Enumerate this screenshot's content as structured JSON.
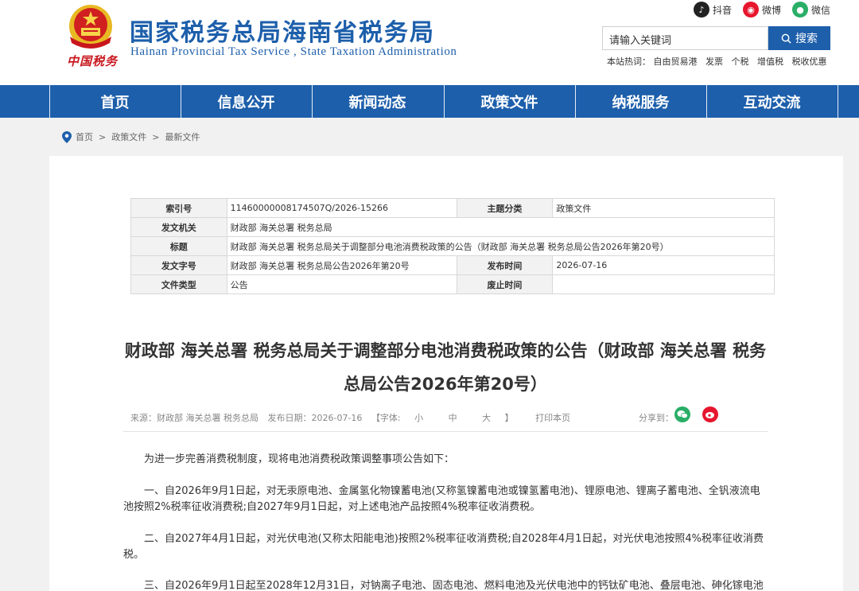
{
  "header": {
    "site_title": "国家税务总局海南省税务局",
    "site_subtitle": "Hainan Provincial Tax Service , State Taxation Administration",
    "seal_text": "中国税务",
    "social": [
      {
        "icon": "douyin-icon",
        "label": "抖音",
        "color": "#222222"
      },
      {
        "icon": "weibo-icon",
        "label": "微博",
        "color": "#e6162d"
      },
      {
        "icon": "wechat-icon",
        "label": "微信",
        "color": "#2aae67"
      }
    ],
    "search_placeholder": "请输入关键词",
    "search_button": "搜索",
    "hot_label": "本站热词：",
    "hot_words": [
      "自由贸易港",
      "发票",
      "个税",
      "增值税",
      "税收优惠"
    ]
  },
  "nav": [
    "首页",
    "信息公开",
    "新闻动态",
    "政策文件",
    "纳税服务",
    "互动交流"
  ],
  "breadcrumb": [
    "首页",
    "政策文件",
    "最新文件"
  ],
  "meta": {
    "index_label": "索引号",
    "index_value": "11460000008174507Q/2026-15266",
    "topic_label": "主题分类",
    "topic_value": "政策文件",
    "issuer_label": "发文机关",
    "issuer_value": "财政部 海关总署 税务总局",
    "title_label": "标题",
    "title_value": "财政部 海关总署 税务总局关于调整部分电池消费税政策的公告（财政部 海关总署 税务总局公告2026年第20号）",
    "docno_label": "发文字号",
    "docno_value": "财政部 海关总署 税务总局公告2026年第20号",
    "pubdate_label": "发布时间",
    "pubdate_value": "2026-07-16",
    "type_label": "文件类型",
    "type_value": "公告",
    "abolish_label": "废止时间",
    "abolish_value": ""
  },
  "doc_title": "财政部 海关总署 税务总局关于调整部分电池消费税政策的公告（财政部 海关总署 税务总局公告2026年第20号）",
  "info": {
    "source": "来源：财政部 海关总署 税务总局",
    "date": "发布日期：2026-07-16",
    "font_label": "【字体:",
    "font_small": "小",
    "font_medium": "中",
    "font_large": "大",
    "font_end": "】",
    "print": "打印本页",
    "share": "分享到："
  },
  "body": [
    "为进一步完善消费税制度，现将电池消费税政策调整事项公告如下：",
    "一、自2026年9月1日起，对无汞原电池、金属氢化物镍蓄电池(又称氢镍蓄电池或镍氢蓄电池)、锂原电池、锂离子蓄电池、全钒液流电池按照2%税率征收消费税;自2027年9月1日起，对上述电池产品按照4%税率征收消费税。",
    "二、自2027年4月1日起，对光伏电池(又称太阳能电池)按照2%税率征收消费税;自2028年4月1日起，对光伏电池按照4%税率征收消费税。",
    "三、自2026年9月1日起至2028年12月31日，对钠离子电池、固态电池、燃料电池及光伏电池中的钙钛矿电池、叠层电池、砷化镓电池"
  ]
}
